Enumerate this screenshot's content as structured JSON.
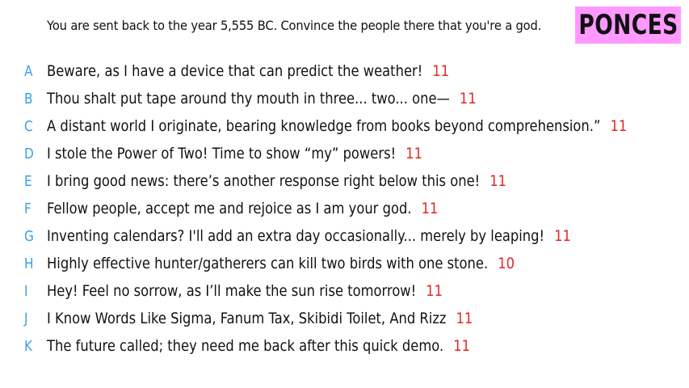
{
  "prompt": "You are sent back to the year 5,555 BC. Convince the people there that you're a god.",
  "logo": "PONCES",
  "colors": {
    "letter": "#3aa0e6",
    "score": "#e32626",
    "logo_bg": "#ff99ff"
  },
  "answers": [
    {
      "letter": "A",
      "text": "Beware, as I have a device that can predict the weather!",
      "score": "11"
    },
    {
      "letter": "B",
      "text": "Thou shalt put tape around thy mouth in three... two... one—",
      "score": "11"
    },
    {
      "letter": "C",
      "text": "A distant world I originate, bearing knowledge from books beyond comprehension.”",
      "score": "11"
    },
    {
      "letter": "D",
      "text": "I stole the Power of Two! Time to show “my” powers!",
      "score": "11"
    },
    {
      "letter": "E",
      "text": "I bring good news: there’s another response right below this one!",
      "score": "11"
    },
    {
      "letter": "F",
      "text": "Fellow people, accept me and rejoice as I am your god.",
      "score": "11"
    },
    {
      "letter": "G",
      "text": "Inventing calendars? I'll add an extra day occasionally... merely by leaping!",
      "score": "11"
    },
    {
      "letter": "H",
      "text": "Highly effective hunter/gatherers can kill two birds with one stone.",
      "score": "10"
    },
    {
      "letter": "I",
      "text": "Hey! Feel no sorrow, as I’ll make the sun rise tomorrow!",
      "score": "11"
    },
    {
      "letter": "J",
      "text": "I Know Words Like Sigma, Fanum Tax, Skibidi Toilet, And Rizz",
      "score": "11"
    },
    {
      "letter": "K",
      "text": "The future called; they need me back after this quick demo.",
      "score": "11"
    }
  ]
}
